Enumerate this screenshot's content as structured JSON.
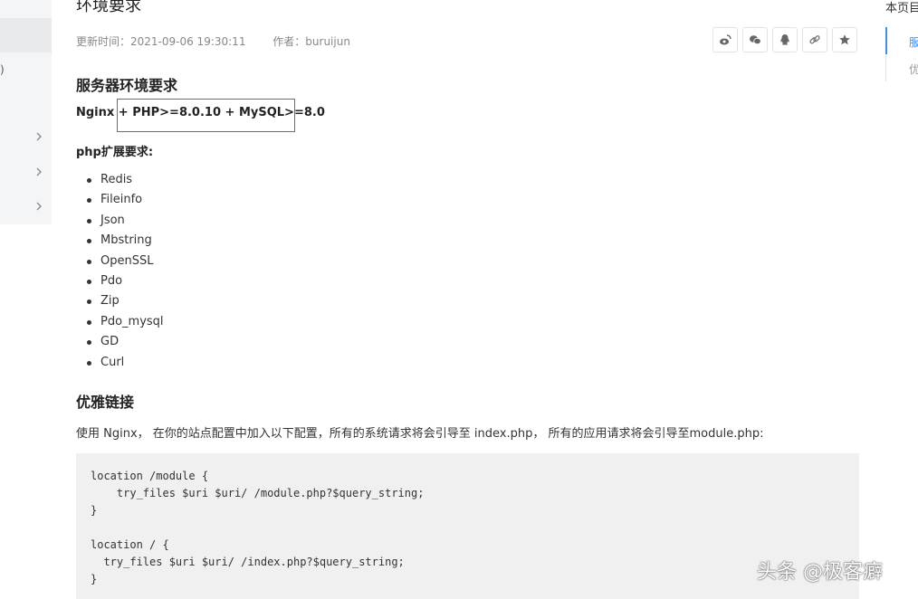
{
  "sidebar": {
    "paren": ")"
  },
  "article": {
    "title": "环境要求",
    "updated": "更新时间：2021-09-06 19:30:11",
    "author": "作者：buruijun",
    "section_server": "服务器环境要求",
    "requirement": "Nginx + PHP>=8.0.10 + MySQL>=8.0",
    "ext_title": "php扩展要求:",
    "extensions": [
      "Redis",
      "Fileinfo",
      "Json",
      "Mbstring",
      "OpenSSL",
      "Pdo",
      "Zip",
      "Pdo_mysql",
      "GD",
      "Curl"
    ],
    "section_pretty": "优雅链接",
    "paragraph": "使用 Nginx， 在你的站点配置中加入以下配置，所有的系统请求将会引导至 index.php， 所有的应用请求将会引导至module.php:",
    "code_lines": [
      "location /module {",
      "    try_files $uri $uri/ /module.php?$query_string;",
      "}",
      "",
      "location / {",
      "  try_files $uri $uri/ /index.php?$query_string;",
      "}"
    ]
  },
  "share_icons": [
    "weibo-icon",
    "wechat-icon",
    "qq-icon",
    "link-icon",
    "star-icon"
  ],
  "toc": {
    "title": "本页目",
    "item_1": "服",
    "item_2": "优"
  },
  "watermark": "头条 @极客癖",
  "colors": {
    "highlight_border": "#e23b3b",
    "toc_active": "#3e8ef7",
    "code_bg": "#f0f0f0"
  }
}
